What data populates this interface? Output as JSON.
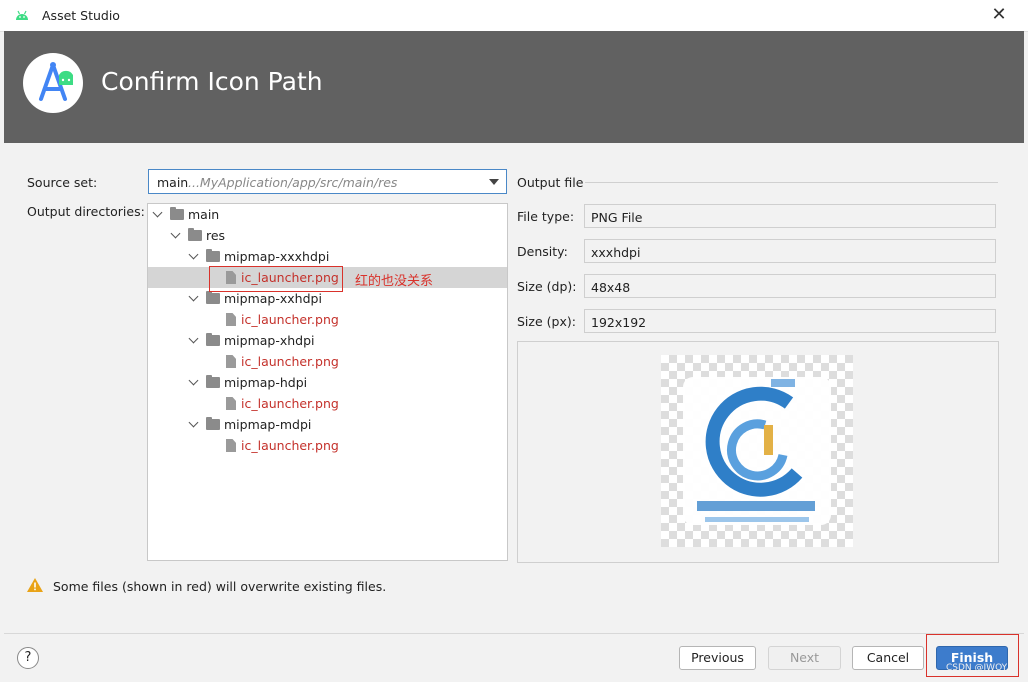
{
  "window": {
    "title": "Asset Studio",
    "close_symbol": "✕"
  },
  "banner": {
    "heading": "Confirm Icon Path"
  },
  "form": {
    "source_set_label": "Source set:",
    "source_set_value": "main",
    "source_set_path": "...MyApplication/app/src/main/res",
    "output_dirs_label": "Output directories:"
  },
  "tree": [
    {
      "label": "main",
      "type": "folder",
      "expanded": true
    },
    {
      "label": "res",
      "type": "folder",
      "expanded": true
    },
    {
      "label": "mipmap-xxxhdpi",
      "type": "folder",
      "expanded": true
    },
    {
      "label": "ic_launcher.png",
      "type": "file",
      "overwrite": true,
      "selected": true
    },
    {
      "label": "mipmap-xxhdpi",
      "type": "folder",
      "expanded": true
    },
    {
      "label": "ic_launcher.png",
      "type": "file",
      "overwrite": true
    },
    {
      "label": "mipmap-xhdpi",
      "type": "folder",
      "expanded": true
    },
    {
      "label": "ic_launcher.png",
      "type": "file",
      "overwrite": true
    },
    {
      "label": "mipmap-hdpi",
      "type": "folder",
      "expanded": true
    },
    {
      "label": "ic_launcher.png",
      "type": "file",
      "overwrite": true
    },
    {
      "label": "mipmap-mdpi",
      "type": "folder",
      "expanded": true
    },
    {
      "label": "ic_launcher.png",
      "type": "file",
      "overwrite": true
    }
  ],
  "annotation": "红的也没关系",
  "output_file": {
    "section_title": "Output file",
    "file_type_label": "File type:",
    "file_type_value": "PNG File",
    "density_label": "Density:",
    "density_value": "xxxhdpi",
    "size_dp_label": "Size (dp):",
    "size_dp_value": "48x48",
    "size_px_label": "Size (px):",
    "size_px_value": "192x192"
  },
  "warning": {
    "text": "Some files (shown in red) will overwrite existing files."
  },
  "buttons": {
    "help": "?",
    "previous": "Previous",
    "next": "Next",
    "cancel": "Cancel",
    "finish": "Finish"
  },
  "watermark": "CSDN @JWOY",
  "colors": {
    "accent": "#3d7ccc",
    "banner": "#616161",
    "overwrite_red": "#c4312b",
    "annotation_red": "#d9322b"
  }
}
